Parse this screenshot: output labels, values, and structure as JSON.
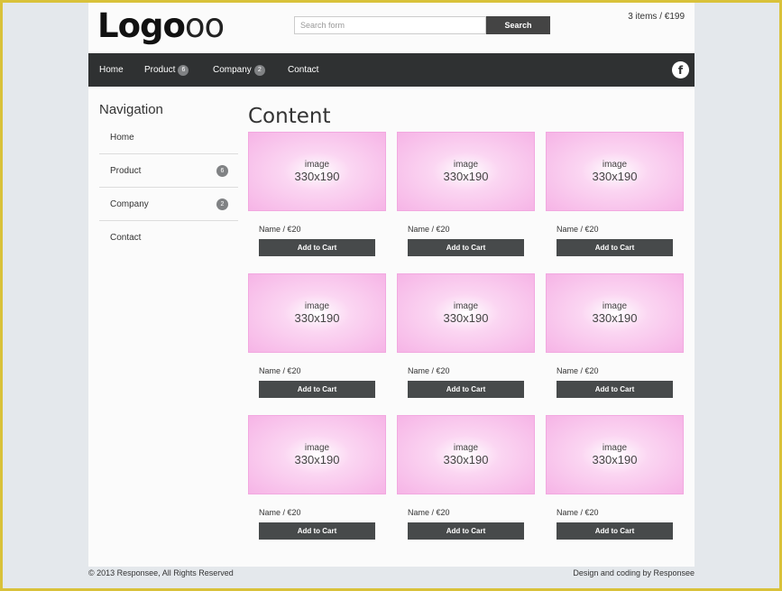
{
  "header": {
    "logo_bold": "Logo",
    "logo_thin": "oo",
    "search_placeholder": "Search form",
    "search_button": "Search",
    "cart_summary": "3 items / €199"
  },
  "nav": {
    "items": [
      {
        "label": "Home",
        "badge": ""
      },
      {
        "label": "Product",
        "badge": "6"
      },
      {
        "label": "Company",
        "badge": "2"
      },
      {
        "label": "Contact",
        "badge": ""
      }
    ],
    "social_icon": "facebook-icon",
    "social_glyph": "f"
  },
  "sidebar": {
    "title": "Navigation",
    "items": [
      {
        "label": "Home",
        "badge": ""
      },
      {
        "label": "Product",
        "badge": "6"
      },
      {
        "label": "Company",
        "badge": "2"
      },
      {
        "label": "Contact",
        "badge": ""
      }
    ]
  },
  "content": {
    "title": "Content",
    "products": [
      {
        "img_line1": "image",
        "img_line2": "330x190",
        "name": "Name / €20",
        "button": "Add to Cart"
      },
      {
        "img_line1": "image",
        "img_line2": "330x190",
        "name": "Name / €20",
        "button": "Add to Cart"
      },
      {
        "img_line1": "image",
        "img_line2": "330x190",
        "name": "Name / €20",
        "button": "Add to Cart"
      },
      {
        "img_line1": "image",
        "img_line2": "330x190",
        "name": "Name / €20",
        "button": "Add to Cart"
      },
      {
        "img_line1": "image",
        "img_line2": "330x190",
        "name": "Name / €20",
        "button": "Add to Cart"
      },
      {
        "img_line1": "image",
        "img_line2": "330x190",
        "name": "Name / €20",
        "button": "Add to Cart"
      },
      {
        "img_line1": "image",
        "img_line2": "330x190",
        "name": "Name / €20",
        "button": "Add to Cart"
      },
      {
        "img_line1": "image",
        "img_line2": "330x190",
        "name": "Name / €20",
        "button": "Add to Cart"
      },
      {
        "img_line1": "image",
        "img_line2": "330x190",
        "name": "Name / €20",
        "button": "Add to Cart"
      }
    ]
  },
  "footer": {
    "copyright": "© 2013 Responsee, All Rights Reserved",
    "credit": "Design and coding by Responsee"
  },
  "colors": {
    "navbar": "#2f3132",
    "button": "#474a4b",
    "badge": "#808284",
    "image_placeholder": "#f6b4e6",
    "frame": "#d9c23a"
  }
}
